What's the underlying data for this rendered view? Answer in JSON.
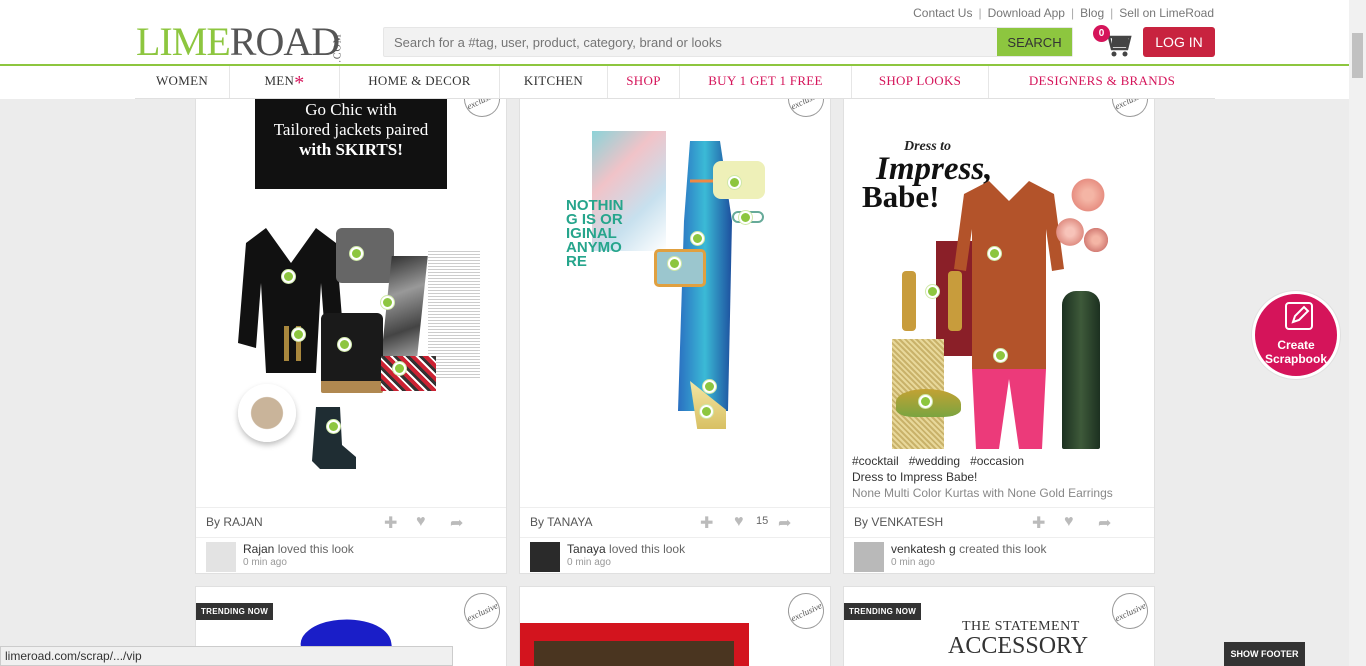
{
  "topbar": {
    "links": [
      "Contact Us",
      "Download App",
      "Blog",
      "Sell on LimeRoad"
    ]
  },
  "logo": {
    "lime": "LIME",
    "road": "ROAD",
    "com": ".COM"
  },
  "search": {
    "placeholder": "Search for a #tag, user, product, category, brand or looks",
    "button": "SEARCH"
  },
  "cart": {
    "count": "0"
  },
  "login": "LOG IN",
  "nav": [
    "WOMEN",
    "MEN",
    "HOME & DECOR",
    "KITCHEN",
    "SHOP",
    "BUY 1 GET 1 FREE",
    "SHOP LOOKS",
    "DESIGNERS & BRANDS"
  ],
  "cards": [
    {
      "banner": [
        "Go Chic with",
        "Tailored jackets paired",
        "with SKIRTS!"
      ],
      "by": "By RAJAN",
      "user": "Rajan",
      "action": "loved this look",
      "time": "0 min ago"
    },
    {
      "art_text": "NOTHING IS ORIGINAL ANYMORE",
      "by": "By TANAYA",
      "likes": "15",
      "user": "Tanaya",
      "action": "loved this look",
      "time": "0 min ago"
    },
    {
      "headline_top": "Dress to",
      "headline_mid": "Impress,",
      "headline_bot": "Babe!",
      "tags": [
        "#cocktail",
        "#wedding",
        "#occasion"
      ],
      "title": "Dress to Impress Babe!",
      "subtitle": "None Multi Color Kurtas with None Gold Earrings",
      "by": "By VENKATESH",
      "user": "venkatesh g",
      "action": "created this look",
      "time": "0 min ago"
    }
  ],
  "row2": {
    "trending": "TRENDING NOW",
    "card3_text_1": "THE STATEMENT",
    "card3_text_2": "ACCESSORY"
  },
  "create": "Create Scrapbook",
  "status_url": "limeroad.com/scrap/.../vip",
  "show_footer": "SHOW FOOTER",
  "colors": {
    "lime": "#8dc63f",
    "pink": "#d5145a",
    "login": "#c8233f"
  }
}
